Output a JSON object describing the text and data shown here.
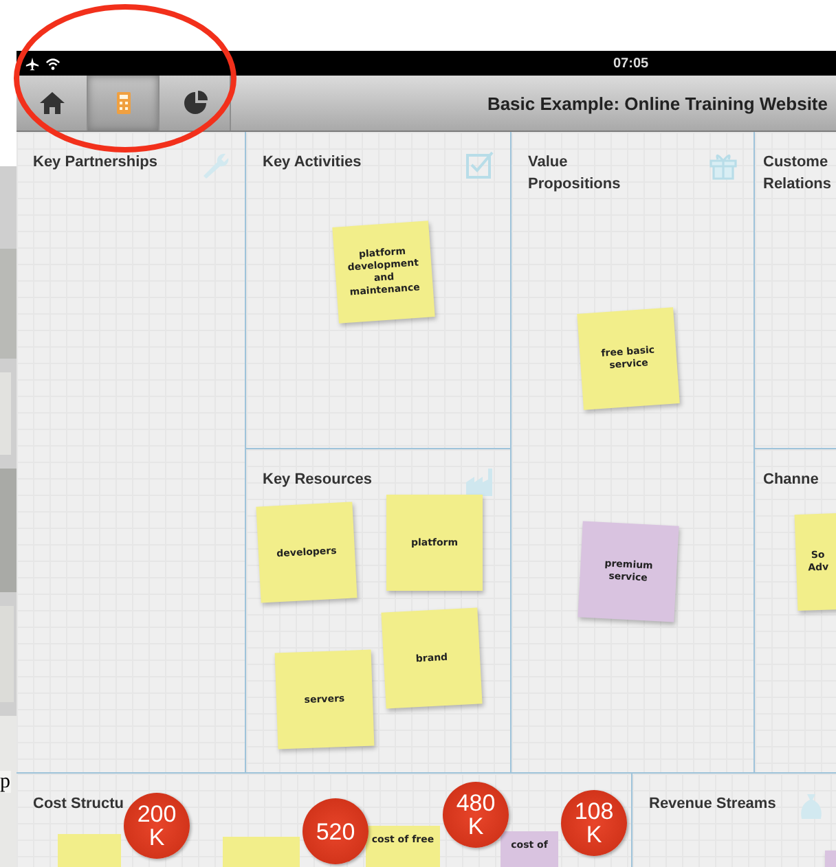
{
  "page_fragment": "p",
  "status_bar": {
    "time": "07:05"
  },
  "toolbar": {
    "buttons": [
      {
        "kind": "home",
        "selected": false
      },
      {
        "kind": "calculator",
        "selected": true
      },
      {
        "kind": "chart",
        "selected": false
      }
    ],
    "title": "Basic Example: Online Training Website"
  },
  "sections": [
    {
      "title": "Key Partnerships"
    },
    {
      "title": "Key Activities",
      "notes": [
        {
          "text": "platform development and maintenance",
          "color": "#f2ee8a"
        }
      ]
    },
    {
      "title": "Key Resources",
      "notes": [
        {
          "text": "developers",
          "color": "#f2ee8a"
        },
        {
          "text": "platform",
          "color": "#f2ee8a"
        },
        {
          "text": "servers",
          "color": "#f2ee8a"
        },
        {
          "text": "brand",
          "color": "#f2ee8a"
        }
      ]
    },
    {
      "title": "Value\nPropositions",
      "notes": [
        {
          "text": "free basic service",
          "color": "#f2ee8a"
        },
        {
          "text": "premium service",
          "color": "#d9c3e0"
        }
      ]
    },
    {
      "title": "Custome\nRelations"
    },
    {
      "title": "Channe",
      "notes": [
        {
          "text": "So\nAdv",
          "color": "#f2ee8a"
        }
      ]
    },
    {
      "title": "Cost Structu",
      "notes": [
        {
          "color": "#f2ee8a"
        },
        {
          "color": "#f2ee8a"
        },
        {
          "text": "cost of free",
          "color": "#f2ee8a"
        },
        {
          "text": "cost of",
          "color": "#d9c3e0"
        }
      ],
      "badges": [
        "200\nK",
        "520",
        "480\nK",
        "108\nK"
      ]
    },
    {
      "title": "Revenue Streams",
      "notes": [
        {
          "color": "#d9c3e0"
        }
      ]
    }
  ]
}
